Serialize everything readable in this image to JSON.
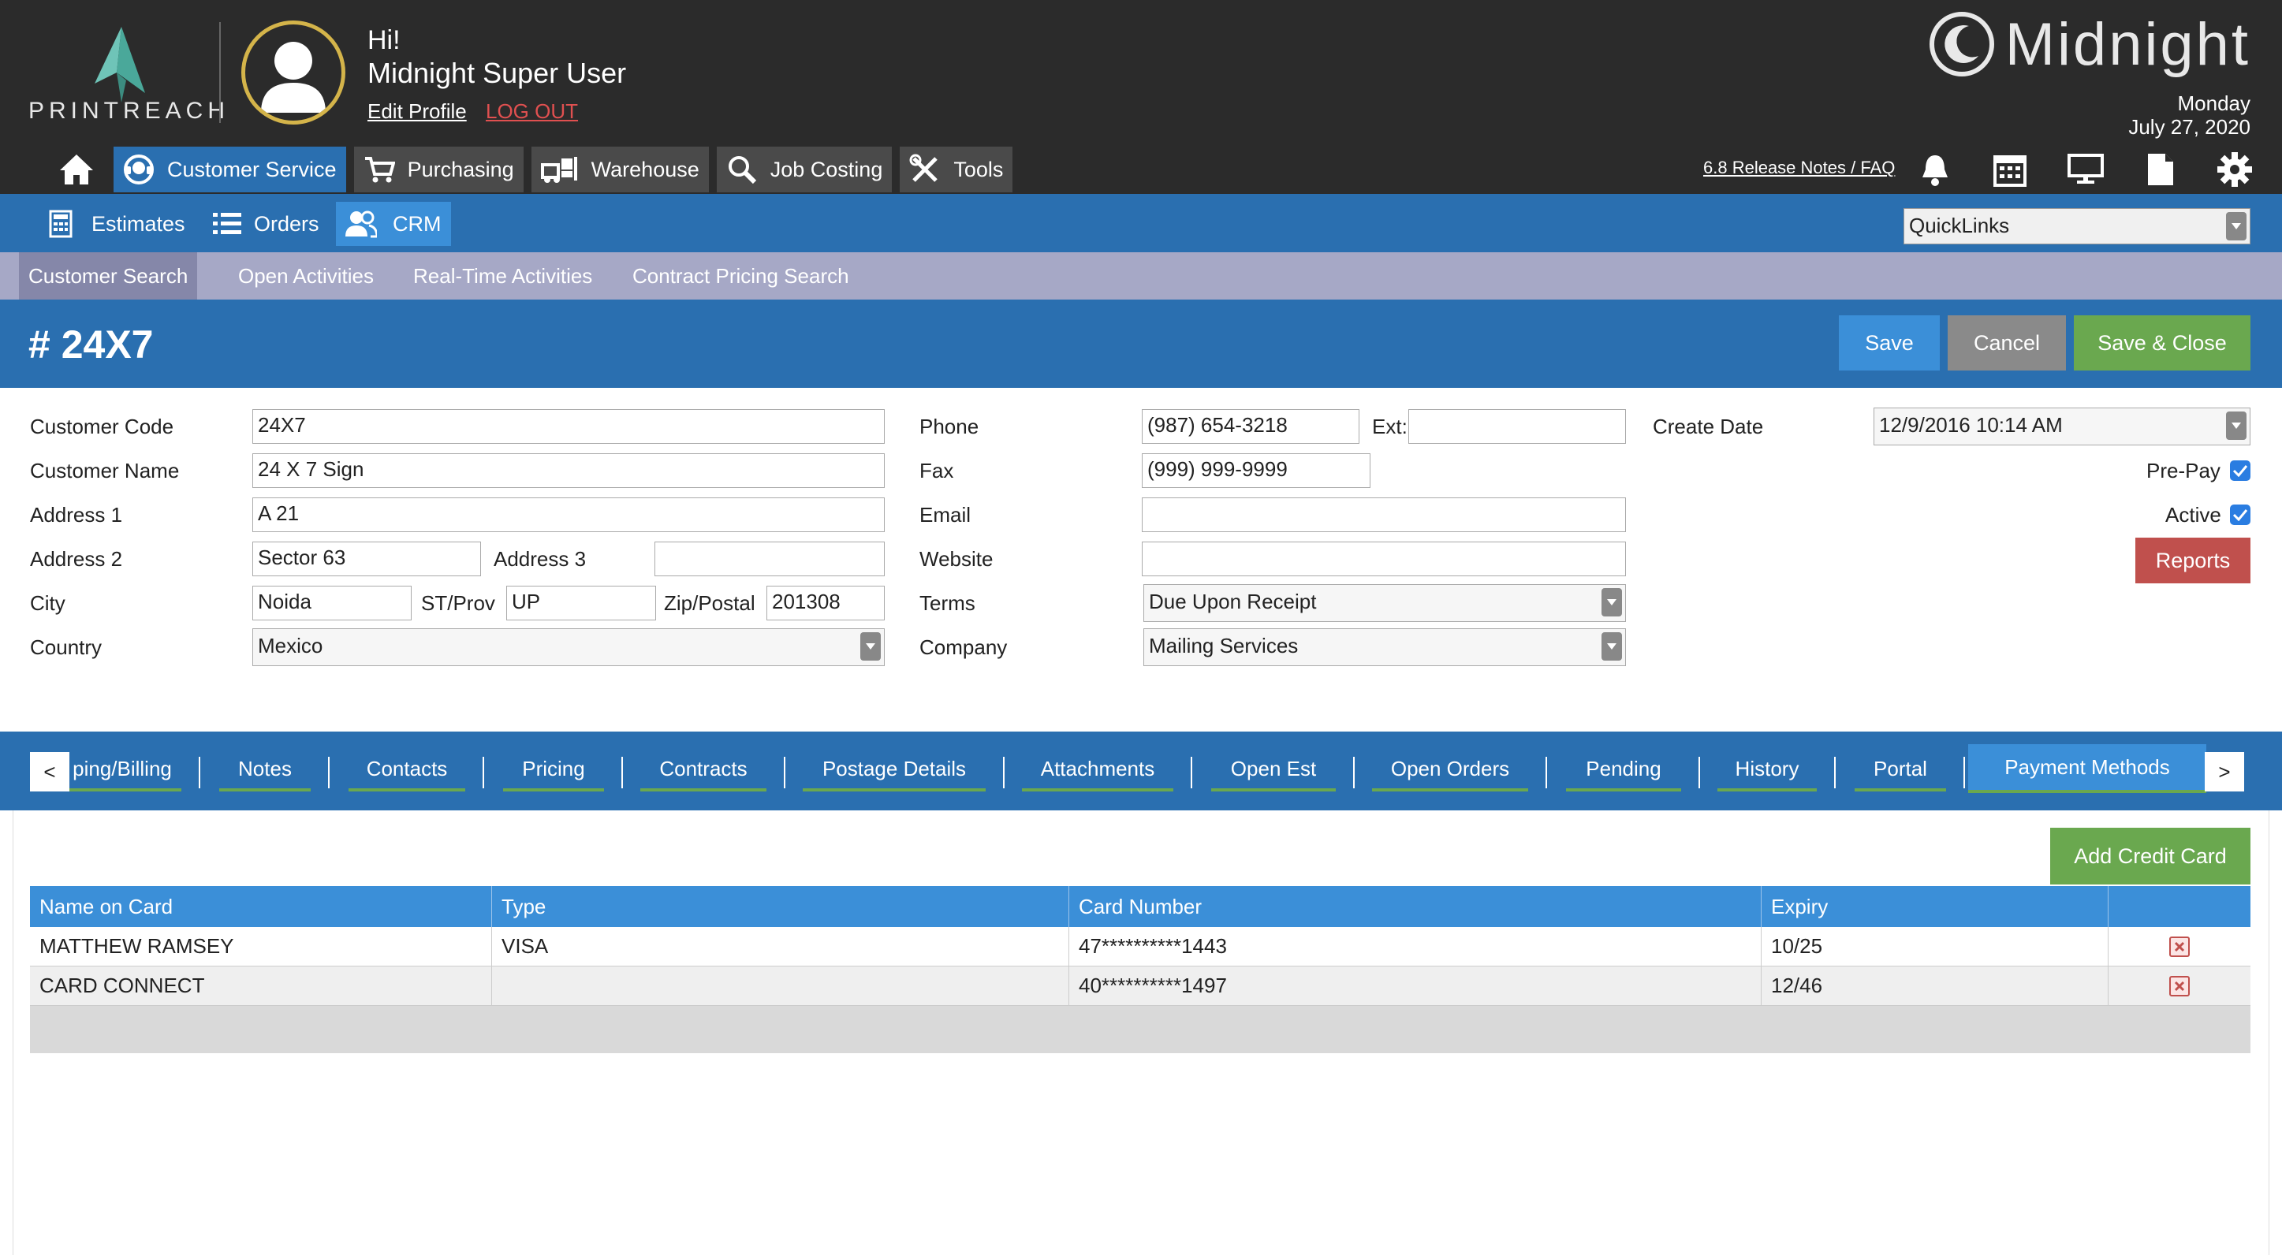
{
  "header": {
    "logo_text": "PRINTREACH",
    "greeting": "Hi!",
    "user_name": "Midnight Super User",
    "edit_profile": "Edit Profile",
    "logout": "LOG OUT",
    "brand": "Midnight",
    "date_day": "Monday",
    "date_full": "July 27, 2020",
    "release_notes": "6.8 Release Notes / FAQ"
  },
  "main_nav": [
    {
      "label": "Customer Service",
      "icon": "customer-service-icon",
      "active": true
    },
    {
      "label": "Purchasing",
      "icon": "cart-icon"
    },
    {
      "label": "Warehouse",
      "icon": "forklift-icon"
    },
    {
      "label": "Job Costing",
      "icon": "magnifier-icon"
    },
    {
      "label": "Tools",
      "icon": "tools-icon"
    }
  ],
  "sub_nav": [
    {
      "label": "Estimates",
      "icon": "calculator-icon"
    },
    {
      "label": "Orders",
      "icon": "list-icon"
    },
    {
      "label": "CRM",
      "icon": "users-icon",
      "active": true
    }
  ],
  "quicklinks": {
    "value": "QuickLinks"
  },
  "tert_nav": [
    {
      "label": "Customer Search",
      "active": true
    },
    {
      "label": "Open Activities"
    },
    {
      "label": "Real-Time Activities"
    },
    {
      "label": "Contract Pricing Search"
    }
  ],
  "record": {
    "title": "# 24X7",
    "save": "Save",
    "cancel": "Cancel",
    "save_close": "Save & Close"
  },
  "form": {
    "customer_code": {
      "label": "Customer Code",
      "value": "24X7"
    },
    "customer_name": {
      "label": "Customer Name",
      "value": "24 X 7 Sign"
    },
    "address1": {
      "label": "Address 1",
      "value": "A 21"
    },
    "address2": {
      "label": "Address 2",
      "value": "Sector 63"
    },
    "address3": {
      "label": "Address 3",
      "value": ""
    },
    "city": {
      "label": "City",
      "value": "Noida"
    },
    "stprov": {
      "label": "ST/Prov",
      "value": "UP"
    },
    "zip": {
      "label": "Zip/Postal",
      "value": "201308"
    },
    "country": {
      "label": "Country",
      "value": "Mexico"
    },
    "phone": {
      "label": "Phone",
      "value": "(987) 654-3218"
    },
    "ext": {
      "label": "Ext:",
      "value": ""
    },
    "fax": {
      "label": "Fax",
      "value": "(999) 999-9999"
    },
    "email": {
      "label": "Email",
      "value": ""
    },
    "website": {
      "label": "Website",
      "value": ""
    },
    "terms": {
      "label": "Terms",
      "value": "Due Upon Receipt"
    },
    "company": {
      "label": "Company",
      "value": "Mailing Services"
    },
    "create_date": {
      "label": "Create Date",
      "value": "12/9/2016 10:14 AM"
    },
    "prepay": {
      "label": "Pre-Pay",
      "checked": true
    },
    "active": {
      "label": "Active",
      "checked": true
    },
    "reports": "Reports"
  },
  "tabs": {
    "left_arrow": "<",
    "right_arrow": ">",
    "items": [
      {
        "label": "Shipping/Billing",
        "visible_label": "ping/Billing"
      },
      {
        "label": "Notes"
      },
      {
        "label": "Contacts"
      },
      {
        "label": "Pricing"
      },
      {
        "label": "Contracts"
      },
      {
        "label": "Postage Details"
      },
      {
        "label": "Attachments"
      },
      {
        "label": "Open Est"
      },
      {
        "label": "Open Orders"
      },
      {
        "label": "Pending"
      },
      {
        "label": "History"
      },
      {
        "label": "Portal"
      },
      {
        "label": "Payment Methods",
        "active": true
      }
    ]
  },
  "payment": {
    "add_button": "Add Credit Card",
    "columns": [
      "Name on Card",
      "Type",
      "Card Number",
      "Expiry",
      ""
    ],
    "rows": [
      {
        "name": "MATTHEW RAMSEY",
        "type": "VISA",
        "number": "47**********1443",
        "expiry": "10/25"
      },
      {
        "name": "CARD CONNECT",
        "type": "",
        "number": "40**********1497",
        "expiry": "12/46"
      }
    ]
  },
  "colors": {
    "header_bg": "#2b2b2b",
    "primary_blue": "#2a6fb0",
    "accent_blue": "#3b8fd8",
    "lavender": "#a6a8c6",
    "green": "#6aa84f",
    "red": "#c0504d"
  }
}
